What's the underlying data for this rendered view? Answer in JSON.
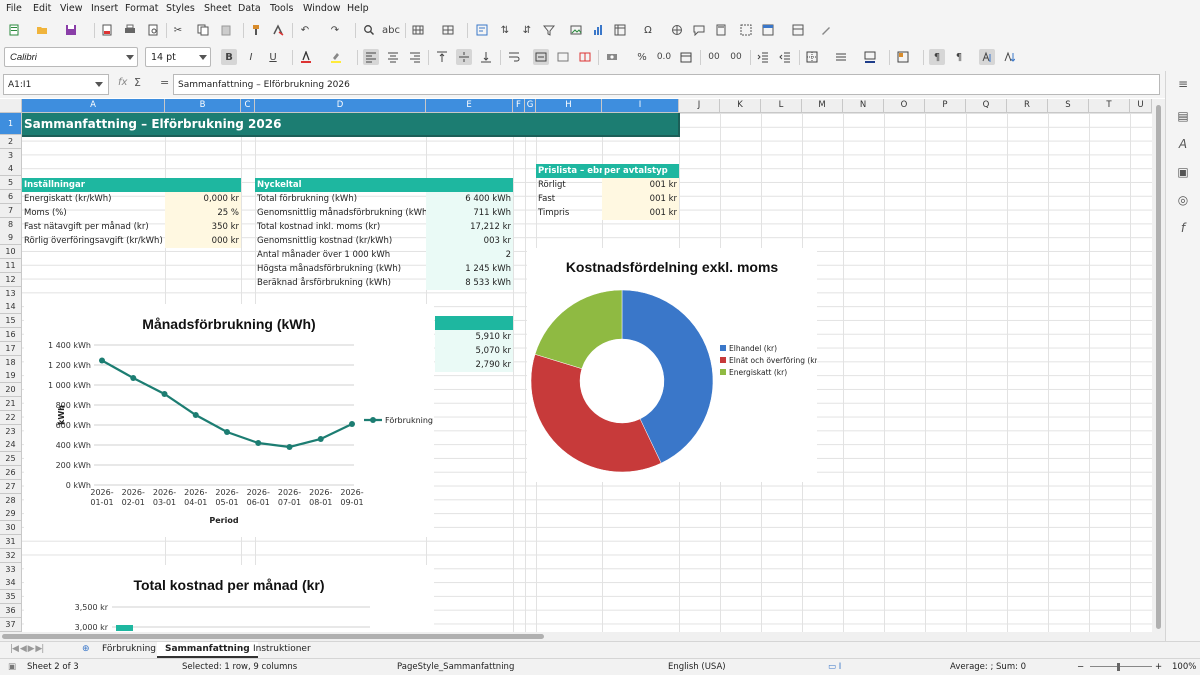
{
  "menu": [
    "File",
    "Edit",
    "View",
    "Insert",
    "Format",
    "Styles",
    "Sheet",
    "Data",
    "Tools",
    "Window",
    "Help"
  ],
  "toolbar": {
    "font_name": "Calibri",
    "font_size": "14 pt",
    "bold": "B",
    "italic": "I",
    "underline": "U",
    "percent": "%",
    "decimal": "0.0",
    "zeros": "00"
  },
  "formula_bar": {
    "cell_ref": "A1:I1",
    "fx": "fx",
    "sum": "Σ",
    "equals": "=",
    "content": "Sammanfattning – Elförbrukning 2026"
  },
  "columns": [
    "A",
    "B",
    "C",
    "D",
    "E",
    "F",
    "G",
    "H",
    "I",
    "J",
    "K",
    "L",
    "M",
    "N",
    "O",
    "P",
    "Q",
    "R",
    "S",
    "T",
    "U"
  ],
  "rows": [
    "1",
    "2",
    "3",
    "4",
    "5",
    "6",
    "7",
    "8",
    "9",
    "10",
    "11",
    "12",
    "13",
    "14",
    "15",
    "16",
    "17",
    "18",
    "19",
    "20",
    "21",
    "22",
    "23",
    "24",
    "25",
    "26",
    "27",
    "28",
    "29",
    "30",
    "31",
    "32",
    "33",
    "34",
    "35",
    "36",
    "37"
  ],
  "sheet": {
    "title": "Sammanfattning – Elförbrukning 2026",
    "settings": {
      "header": "Inställningar",
      "rows": [
        {
          "label": "Energiskatt (kr/kWh)",
          "value": "0,000 kr"
        },
        {
          "label": "Moms (%)",
          "value": "25 %"
        },
        {
          "label": "Fast nätavgift per månad (kr)",
          "value": "350 kr"
        },
        {
          "label": "Rörlig överföringsavgift (kr/kWh)",
          "value": "000 kr"
        }
      ]
    },
    "kpi": {
      "header": "Nyckeltal",
      "rows": [
        {
          "label": "Total förbrukning (kWh)",
          "value": "6 400 kWh"
        },
        {
          "label": "Genomsnittlig månadsförbrukning (kWh)",
          "value": "711 kWh"
        },
        {
          "label": "Total kostnad inkl. moms (kr)",
          "value": "17,212 kr"
        },
        {
          "label": "Genomsnittlig kostnad (kr/kWh)",
          "value": "003 kr"
        },
        {
          "label": "Antal månader över 1 000 kWh",
          "value": "2"
        },
        {
          "label": "Högsta månadsförbrukning (kWh)",
          "value": "1 245 kWh"
        },
        {
          "label": "Beräknad årsförbrukning (kWh)",
          "value": "8 533 kWh"
        }
      ]
    },
    "pricelist": {
      "header_left": "Prislista – ebris",
      "header_right": "per avtalstyp",
      "rows": [
        {
          "label": "Rörligt",
          "value": "001 kr"
        },
        {
          "label": "Fast",
          "value": "001 kr"
        },
        {
          "label": "Timpris",
          "value": "001 kr"
        }
      ]
    },
    "cost_values": [
      "5,910 kr",
      "5,070 kr",
      "2,790 kr"
    ]
  },
  "chart_data": [
    {
      "type": "line",
      "title": "Månadsförbrukning (kWh)",
      "xlabel": "Period",
      "ylabel": "kWh",
      "x": [
        "2026-01-01",
        "2026-02-01",
        "2026-03-01",
        "2026-04-01",
        "2026-05-01",
        "2026-06-01",
        "2026-07-01",
        "2026-08-01",
        "2026-09-01"
      ],
      "series": [
        {
          "name": "Förbrukning (kWh)",
          "values": [
            1245,
            1070,
            910,
            700,
            530,
            420,
            380,
            460,
            610
          ]
        }
      ],
      "ylim": [
        0,
        1400
      ],
      "yticks": [
        "0 kWh",
        "200 kWh",
        "400 kWh",
        "600 kWh",
        "800 kWh",
        "1 000 kWh",
        "1 200 kWh",
        "1 400 kWh"
      ],
      "grid": true,
      "legend": "right",
      "color": "#1c7d72"
    },
    {
      "type": "pie",
      "title": "Kostnadsfördelning exkl. moms",
      "categories": [
        "Elhandel (kr)",
        "Elnät och överföring (kr)",
        "Energiskatt (kr)"
      ],
      "values": [
        5910,
        5070,
        2790
      ],
      "colors": [
        "#3a77c9",
        "#c73a3a",
        "#8fba42"
      ],
      "legend": "right"
    },
    {
      "type": "bar",
      "title": "Total kostnad per månad (kr)",
      "yticks": [
        "3,000 kr",
        "3,500 kr"
      ],
      "ylim": [
        3000,
        3500
      ],
      "color": "#1eb7a0"
    }
  ],
  "tabs": [
    "Förbrukning",
    "Sammanfattning",
    "Instruktioner"
  ],
  "status": {
    "sheet": "Sheet 2 of 3",
    "selection": "Selected: 1 row, 9 columns",
    "pagestyle": "PageStyle_Sammanfattning",
    "language": "English (USA)",
    "summary": "Average: ; Sum: 0",
    "zoom": "100%"
  }
}
